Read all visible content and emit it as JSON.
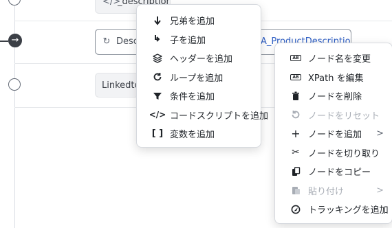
{
  "canvas": {
    "chip_top_label": "_descriptions",
    "chip_desc_label": "Desc",
    "chip_desc_tail": "A_ProductDescription",
    "chip_linked_label": "Linkedto"
  },
  "context_menu": {
    "items": [
      {
        "label": "兄弟を追加",
        "icon": "arrow-down-icon"
      },
      {
        "label": "子を追加",
        "icon": "child-arrow-icon"
      },
      {
        "label": "ヘッダーを追加",
        "icon": "layers-icon"
      },
      {
        "label": "ループを追加",
        "icon": "loop-icon"
      },
      {
        "label": "条件を追加",
        "icon": "filter-icon"
      },
      {
        "label": "コードスクリプトを追加",
        "icon": "code-icon"
      },
      {
        "label": "変数を追加",
        "icon": "brackets-icon"
      }
    ]
  },
  "node_menu": {
    "items": [
      {
        "label": "ノード名を変更",
        "icon": "rename-icon",
        "disabled": false
      },
      {
        "label": "XPath を編集",
        "icon": "rename-icon",
        "disabled": false
      },
      {
        "label": "ノードを削除",
        "icon": "trash-icon",
        "disabled": false
      },
      {
        "label": "ノードをリセット",
        "icon": "reset-icon",
        "disabled": true
      },
      {
        "label": "ノードを追加",
        "icon": "plus-icon",
        "disabled": false,
        "submenu": ">"
      },
      {
        "label": "ノードを切り取り",
        "icon": "scissors-icon",
        "disabled": false
      },
      {
        "label": "ノードをコピー",
        "icon": "copy-icon",
        "disabled": false
      },
      {
        "label": "貼り付け",
        "icon": "paste-icon",
        "disabled": true,
        "submenu": ">"
      },
      {
        "label": "トラッキングを追加",
        "icon": "tracking-icon",
        "disabled": false
      }
    ]
  }
}
